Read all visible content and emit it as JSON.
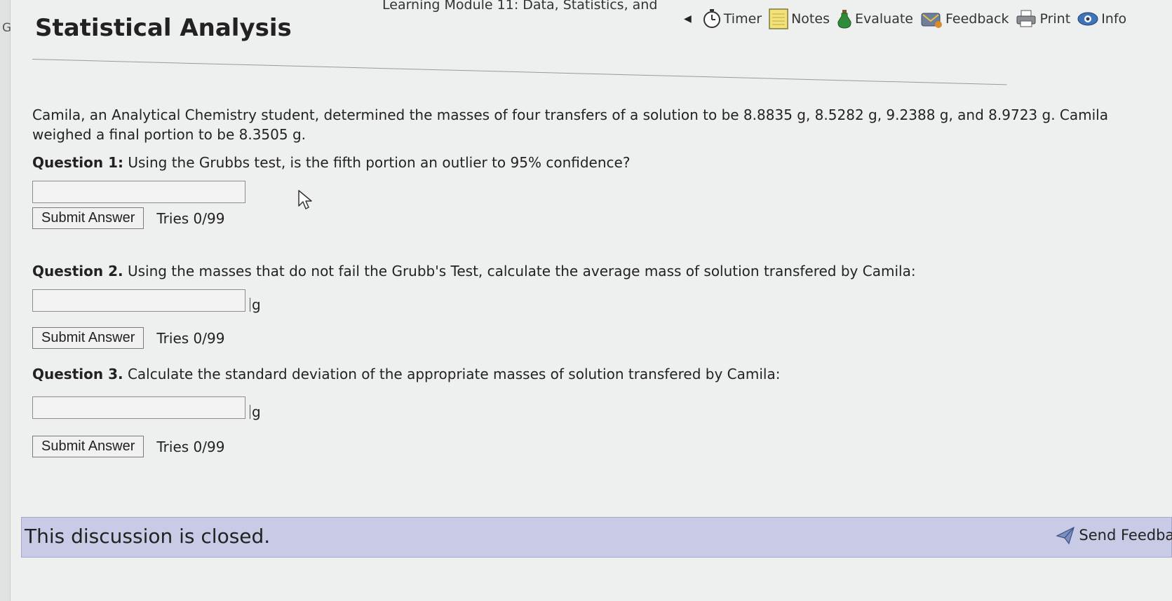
{
  "header": {
    "breadcrumb": "Learning Module 11: Data, Statistics, and",
    "title": "Statistical Analysis",
    "left_letter": "G"
  },
  "toolbar": {
    "items": [
      {
        "label": "Timer",
        "icon": "timer-icon"
      },
      {
        "label": "Notes",
        "icon": "notes-icon"
      },
      {
        "label": "Evaluate",
        "icon": "evaluate-icon"
      },
      {
        "label": "Feedback",
        "icon": "feedback-icon"
      },
      {
        "label": "Print",
        "icon": "print-icon"
      },
      {
        "label": "Info",
        "icon": "info-icon"
      }
    ]
  },
  "problem": {
    "text": "Camila, an Analytical Chemistry student, determined the masses of four transfers of a solution to be 8.8835 g, 8.5282 g, 9.2388 g, and 8.9723 g. Camila weighed a final portion to be 8.3505 g."
  },
  "questions": [
    {
      "label": "Question 1:",
      "text": "Using the Grubbs test, is the fifth portion an outlier to 95% confidence?",
      "value": "",
      "unit": "",
      "submit_label": "Submit Answer",
      "tries": "Tries 0/99"
    },
    {
      "label": "Question 2.",
      "text": "Using the masses that do not fail the Grubb's Test, calculate the average mass of solution transfered by Camila:",
      "value": "",
      "unit": "g",
      "submit_label": "Submit Answer",
      "tries": "Tries 0/99"
    },
    {
      "label": "Question 3.",
      "text": "Calculate the standard deviation of the appropriate masses of solution transfered by Camila:",
      "value": "",
      "unit": "g",
      "submit_label": "Submit Answer",
      "tries": "Tries 0/99"
    }
  ],
  "discussion": {
    "closed_text": "This discussion is closed.",
    "send_feedback_label": "Send Feedback"
  },
  "colors": {
    "page_background": "#eef0ef",
    "banner_background": "#c9cbe6"
  }
}
